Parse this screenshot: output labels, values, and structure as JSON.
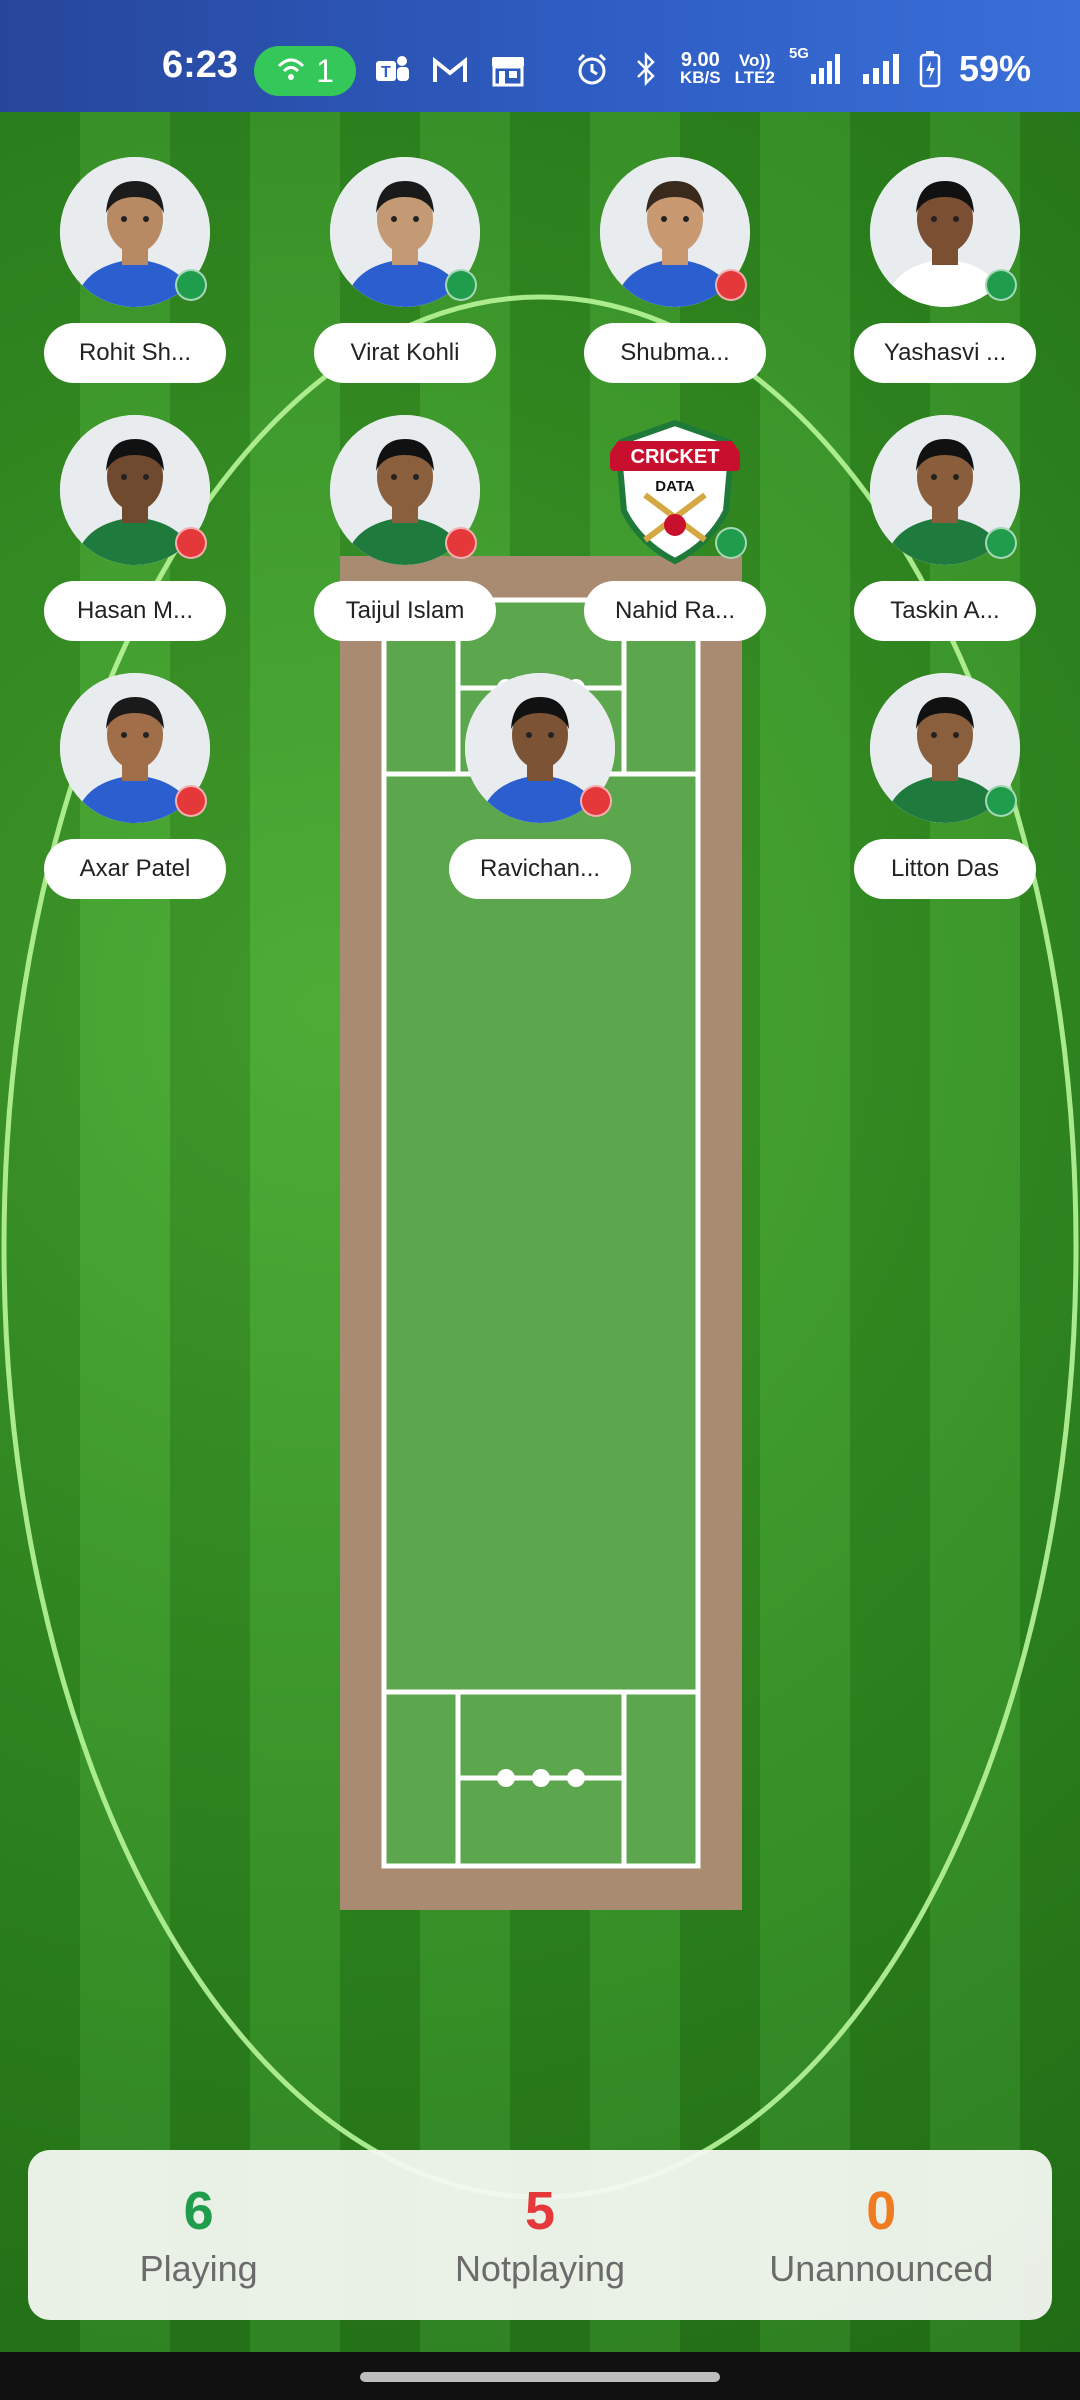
{
  "status_bar": {
    "time": "6:23",
    "hotspot_count": "1",
    "net_speed_top": "9.00",
    "net_speed_unit": "KB/S",
    "volte_top": "Vo))",
    "volte_bottom": "LTE2",
    "signal_label": "5G",
    "battery": "59%"
  },
  "players": [
    {
      "name": "Rohit Sh...",
      "status": "playing",
      "skin": "#b88a63",
      "hair": "#1b1b1b",
      "shirt": "#2b5fcf"
    },
    {
      "name": "Virat Kohli",
      "status": "playing",
      "skin": "#c39a74",
      "hair": "#1a1a1a",
      "shirt": "#2b5fcf"
    },
    {
      "name": "Shubma...",
      "status": "notplaying",
      "skin": "#c99a72",
      "hair": "#3a2a1e",
      "shirt": "#2b5fcf"
    },
    {
      "name": "Yashasvi ...",
      "status": "playing",
      "skin": "#7a4f32",
      "hair": "#111",
      "shirt": "#ffffff"
    },
    {
      "name": "Hasan M...",
      "status": "notplaying",
      "skin": "#6f4a2f",
      "hair": "#111",
      "shirt": "#1e7a3d"
    },
    {
      "name": "Taijul Islam",
      "status": "notplaying",
      "skin": "#8a5f3d",
      "hair": "#111",
      "shirt": "#1e7a3d"
    },
    {
      "name": "Nahid Ra...",
      "status": "playing",
      "logo": true,
      "logo_text_1": "CRICKET",
      "logo_text_2": "DATA"
    },
    {
      "name": "Taskin A...",
      "status": "playing",
      "skin": "#8a5e3c",
      "hair": "#111",
      "shirt": "#1e7a3d"
    },
    {
      "name": "Axar Patel",
      "status": "notplaying",
      "skin": "#a06e48",
      "hair": "#1a1a1a",
      "shirt": "#2b5fcf"
    },
    {
      "name": "Ravichan...",
      "status": "notplaying",
      "skin": "#7d5336",
      "hair": "#111",
      "shirt": "#2b5fcf"
    },
    {
      "name": "Litton Das",
      "status": "playing",
      "skin": "#8a5f3d",
      "hair": "#111",
      "shirt": "#1e7a3d"
    }
  ],
  "summary": {
    "playing_count": "6",
    "playing_label": "Playing",
    "notplaying_count": "5",
    "notplaying_label": "Notplaying",
    "unannounced_count": "0",
    "unannounced_label": "Unannounced"
  },
  "colors": {
    "playing": "#1f9d4c",
    "notplaying": "#e5383b",
    "unannounced": "#f07c22",
    "pitch": "#a98b71",
    "pitch_inner": "#5ca64d"
  }
}
